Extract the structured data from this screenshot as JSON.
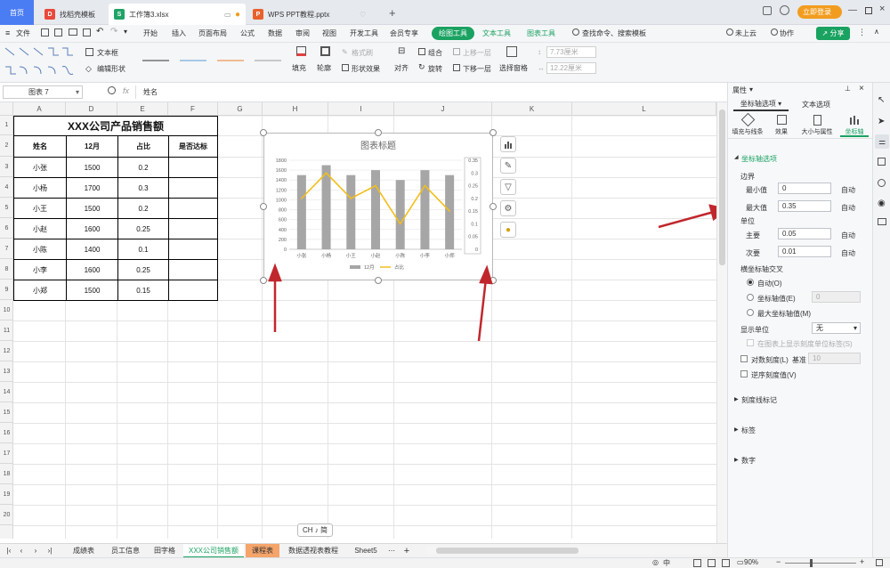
{
  "tabs": [
    {
      "label": "首页"
    },
    {
      "label": "找稻壳模板"
    },
    {
      "label": "工作簿3.xlsx"
    },
    {
      "label": "WPS PPT教程.pptx"
    }
  ],
  "window_controls": {
    "login": "立即登录"
  },
  "menu": [
    "文件",
    "开始",
    "插入",
    "页面布局",
    "公式",
    "数据",
    "审阅",
    "视图",
    "开发工具",
    "会员专享",
    "绘图工具",
    "文本工具",
    "图表工具"
  ],
  "menu_right": {
    "search": "查找命令、搜索模板",
    "cloud": "未上云",
    "collab": "协作",
    "share": "分享"
  },
  "ribbon": {
    "textbox": "文本框",
    "edit_shape": "编辑形状",
    "fill": "填充",
    "outline": "轮廓",
    "format_brush": "格式刷",
    "shape_effect": "形状效果",
    "align": "对齐",
    "group": "组合",
    "rotate": "旋转",
    "bring_forward": "上移一层",
    "send_backward": "下移一层",
    "selection_pane": "选择窗格",
    "height": "7.73厘米",
    "width": "12.22厘米"
  },
  "formula_bar": {
    "namebox": "图表 7",
    "fx": "fx",
    "content": "姓名"
  },
  "columns": [
    "A",
    "D",
    "E",
    "F",
    "G",
    "H",
    "I",
    "J",
    "K",
    "L"
  ],
  "rows": [
    "1",
    "2",
    "3",
    "4",
    "5",
    "6",
    "7",
    "8",
    "9",
    "10",
    "11",
    "12",
    "13",
    "14",
    "15",
    "16",
    "17",
    "18",
    "19",
    "20"
  ],
  "table": {
    "title": "XXX公司产品销售额",
    "headers": [
      "姓名",
      "12月",
      "占比",
      "是否达标"
    ],
    "rows": [
      [
        "小张",
        "1500",
        "0.2",
        ""
      ],
      [
        "小杨",
        "1700",
        "0.3",
        ""
      ],
      [
        "小王",
        "1500",
        "0.2",
        ""
      ],
      [
        "小赵",
        "1600",
        "0.25",
        ""
      ],
      [
        "小陈",
        "1400",
        "0.1",
        ""
      ],
      [
        "小李",
        "1600",
        "0.25",
        ""
      ],
      [
        "小郑",
        "1500",
        "0.15",
        ""
      ]
    ]
  },
  "chart_data": {
    "type": "bar",
    "title": "图表标题",
    "categories": [
      "小张",
      "小杨",
      "小王",
      "小赵",
      "小陈",
      "小李",
      "小郑"
    ],
    "series": [
      {
        "name": "12月",
        "type": "bar",
        "axis": "left",
        "values": [
          1500,
          1700,
          1500,
          1600,
          1400,
          1600,
          1500
        ],
        "color": "#a6a6a6"
      },
      {
        "name": "占比",
        "type": "line",
        "axis": "right",
        "values": [
          0.2,
          0.3,
          0.2,
          0.25,
          0.1,
          0.25,
          0.15
        ],
        "color": "#f2be1d"
      }
    ],
    "y_left": {
      "min": 0,
      "max": 1800,
      "step": 200,
      "ticks": [
        "0",
        "200",
        "400",
        "600",
        "800",
        "1000",
        "1200",
        "1400",
        "1600",
        "1800"
      ]
    },
    "y_right": {
      "min": 0,
      "max": 0.35,
      "step": 0.05,
      "ticks": [
        "0",
        "0.05",
        "0.1",
        "0.15",
        "0.2",
        "0.25",
        "0.3",
        "0.35"
      ]
    },
    "legend": "bottom",
    "grid": true
  },
  "panel": {
    "title": "属性",
    "tab_axis": "坐标轴选项",
    "tab_text": "文本选项",
    "subtabs": [
      "填充与线条",
      "效果",
      "大小与属性",
      "坐标轴"
    ],
    "section": "坐标轴选项",
    "bounds_label": "边界",
    "min_label": "最小值",
    "min_value": "0",
    "min_auto": "自动",
    "max_label": "最大值",
    "max_value": "0.35",
    "max_auto": "自动",
    "unit_label": "单位",
    "major_label": "主要",
    "major_value": "0.05",
    "major_auto": "自动",
    "minor_label": "次要",
    "minor_value": "0.01",
    "minor_auto": "自动",
    "cross_label": "横坐标轴交叉",
    "cross_auto": "自动(O)",
    "cross_value_label": "坐标轴值(E)",
    "cross_value": "0",
    "cross_max": "最大坐标轴值(M)",
    "display_unit_label": "显示单位",
    "display_unit_value": "无",
    "show_unit_label": "在图表上显示刻度单位标签(S)",
    "log_label": "对数刻度(L)",
    "base_label": "基准",
    "base_value": "10",
    "reverse_label": "逆序刻度值(V)",
    "collapsed": [
      "刻度线标记",
      "标签",
      "数字"
    ]
  },
  "sheets": [
    "成绩表",
    "员工信息",
    "田字格",
    "XXX公司销售额",
    "课程表",
    "数据透视表教程",
    "Sheet5"
  ],
  "ime": "CH ♪ 简",
  "status": {
    "zoom": "90%"
  }
}
